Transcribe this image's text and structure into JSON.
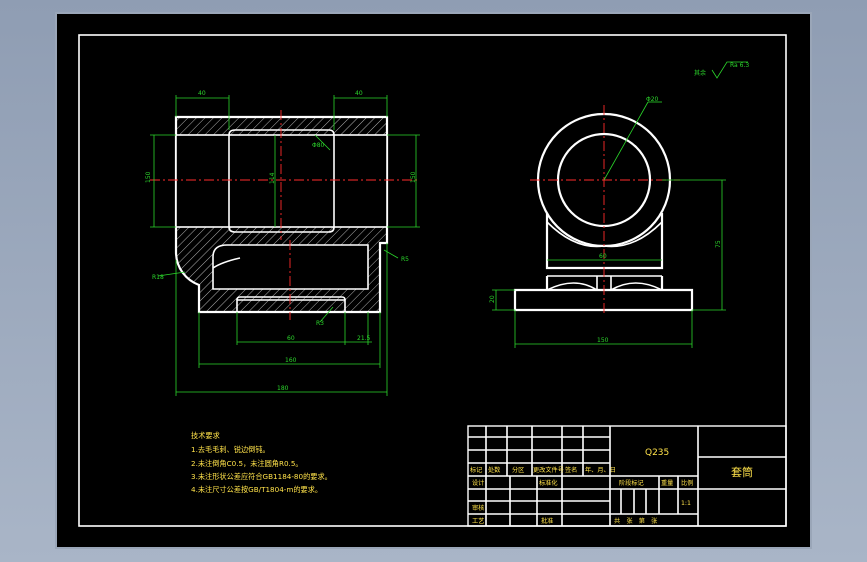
{
  "drawing": {
    "material": "Q235",
    "part_name": "套筒",
    "roughness_label": "其余",
    "roughness_value": "Ra 6.3",
    "notes_title": "技术要求",
    "notes": [
      "1.去毛毛刺、锐边倒钝。",
      "2.未注倒角C0.5，未注圆角R0.5。",
      "3.未注形状公差应符合GB1184-80的要求。",
      "4.未注尺寸公差按GB/T1804-m的要求。"
    ],
    "dims_front": {
      "top_left": "40",
      "top_right": "40",
      "height_left": "150",
      "height_right": "150",
      "center": "114",
      "bore": "Φ80",
      "left_radius": "R18",
      "right_radius": "R5",
      "groove": "R3",
      "slot": "60",
      "offset": "21.5",
      "inner_width": "160",
      "overall_width": "180"
    },
    "dims_side": {
      "diameter": "Φ20",
      "neck": "60",
      "height": "75",
      "base_thk": "20",
      "base_width": "150"
    },
    "title_block": {
      "row_labels": [
        "标记",
        "处数",
        "分区",
        "更改文件号",
        "签名",
        "年、月、日"
      ],
      "design": "设计",
      "standard": "标准化",
      "check": "审核",
      "process": "工艺",
      "approve": "批准",
      "stage": "阶段标记",
      "weight": "重量",
      "scale": "比例",
      "scale_value": "1:1",
      "sheets": "共　张　第　张"
    }
  },
  "colors": {
    "background": "#000000",
    "outline": "#ffffff",
    "dimension": "#2bd62b",
    "centerline": "#ff2b2b",
    "text": "#ffe24a",
    "frame": "#9aa6b8"
  }
}
